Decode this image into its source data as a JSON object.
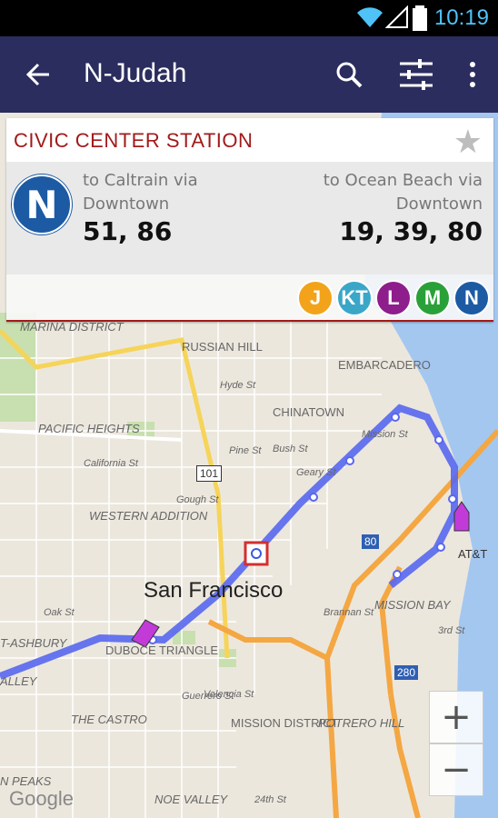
{
  "status": {
    "time": "10:19"
  },
  "appbar": {
    "title": "N-Judah"
  },
  "card": {
    "station": "CIVIC CENTER STATION",
    "main_line": "N",
    "dir1_label": "to Caltrain via Downtown",
    "dir1_times": "51, 86",
    "dir2_label": "to Ocean Beach via Downtown",
    "dir2_times": "19, 39, 80",
    "lines": [
      {
        "label": "J",
        "color": "#f2a31a"
      },
      {
        "label": "KT",
        "color": "#3aa7c9"
      },
      {
        "label": "L",
        "color": "#8e1e8c"
      },
      {
        "label": "M",
        "color": "#2aa138"
      },
      {
        "label": "N",
        "color": "#1c5aa3"
      }
    ]
  },
  "map": {
    "city": "San Francisco",
    "labels": [
      "RUSSIAN HILL",
      "EMBARCADERO",
      "CHINATOWN",
      "PACIFIC HEIGHTS",
      "WESTERN ADDITION",
      "MISSION BAY",
      "DUBOCE TRIANGLE",
      "THE CASTRO",
      "MISSION DISTRICT",
      "POTRERO HILL",
      "T-ASHBURY",
      "ALLEY",
      "N PEAKS",
      "NOE VALLEY",
      "MARINA DISTRICT",
      "AT&T"
    ],
    "streets": [
      "Hyde St",
      "Pine St",
      "Bush St",
      "California St",
      "Geary St",
      "Mission St",
      "Gough St",
      "Oak St",
      "Brannan St",
      "3rd St",
      "Guerrero St",
      "Valencia St",
      "24th St"
    ],
    "shields": [
      "101",
      "80",
      "280"
    ],
    "attribution": "Google"
  },
  "zoom": {
    "plus": "+",
    "minus": "−"
  }
}
